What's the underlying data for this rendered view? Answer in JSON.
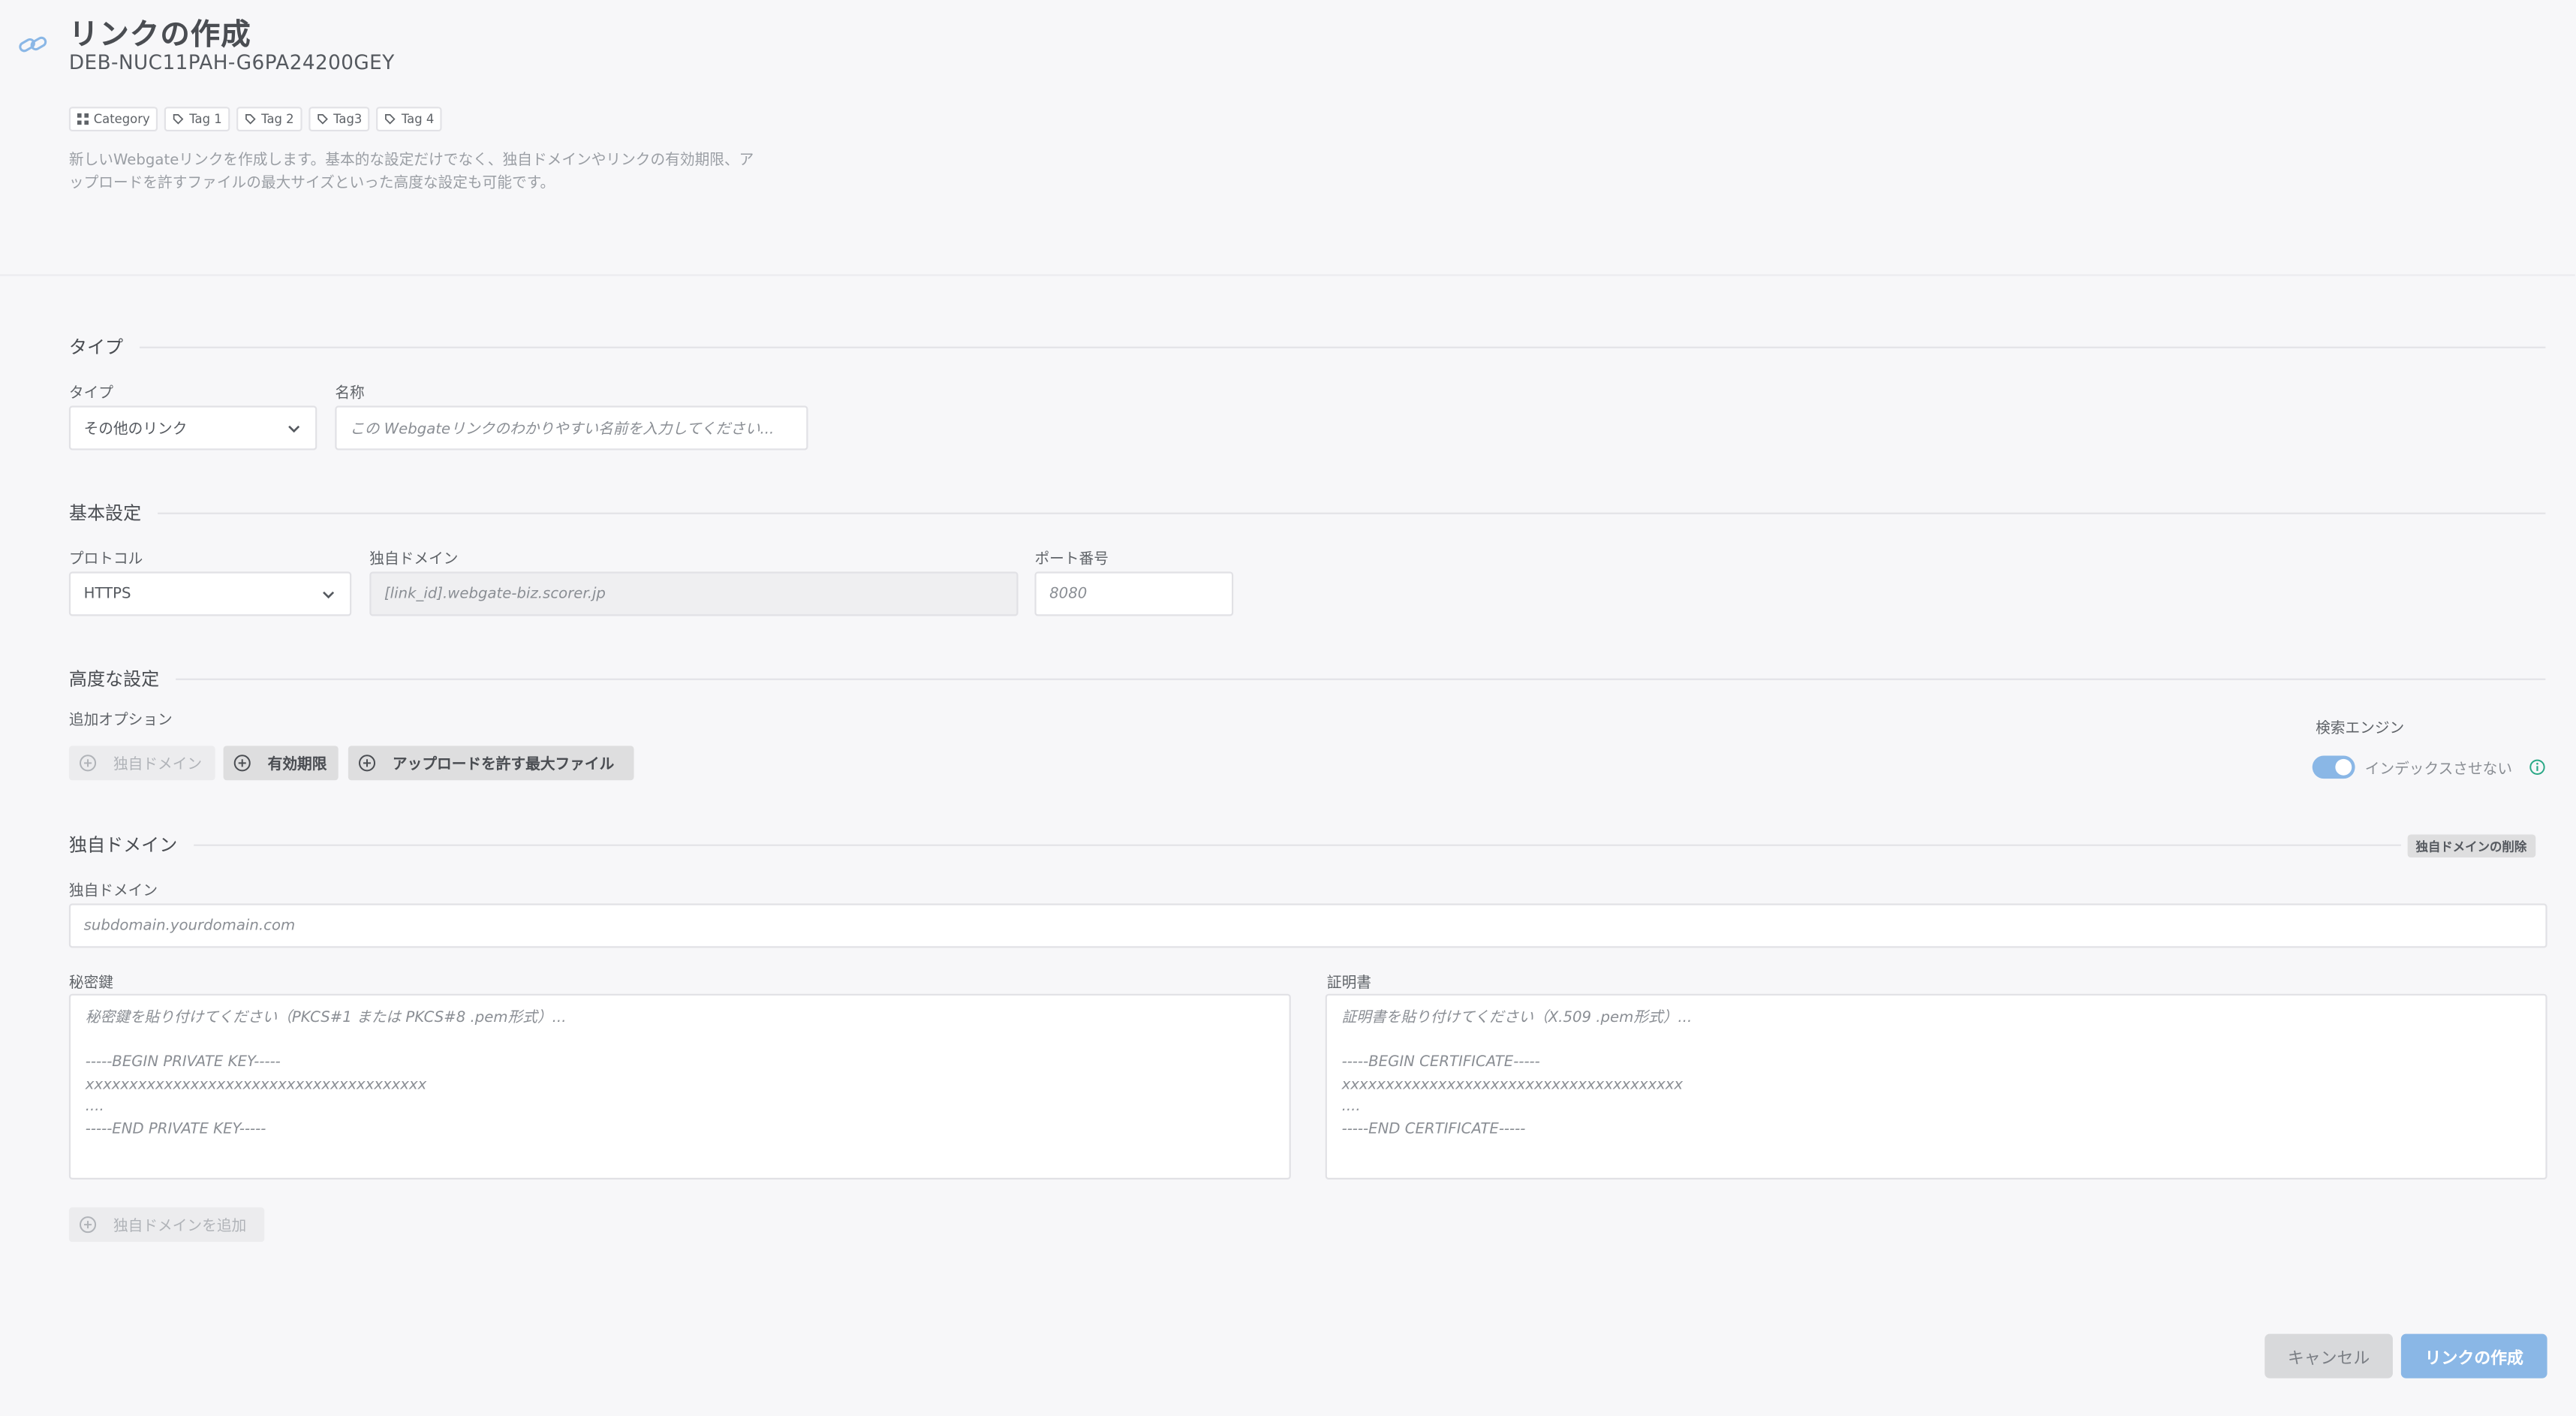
{
  "header": {
    "title": "リンクの作成",
    "subtitle": "DEB-NUC11PAH-G6PA24200GEY",
    "tags": [
      "Category",
      "Tag 1",
      "Tag 2",
      "Tag3",
      "Tag 4"
    ],
    "description_line1": "新しいWebgateリンクを作成します。基本的な設定だけでなく、独自ドメインやリンクの有効期限、ア",
    "description_line2": "ップロードを許すファイルの最大サイズといった高度な設定も可能です。"
  },
  "type_section": {
    "title": "タイプ",
    "type_label": "タイプ",
    "type_value": "その他のリンク",
    "name_label": "名称",
    "name_placeholder": "この Webgateリンクのわかりやすい名前を入力してください..."
  },
  "basic_section": {
    "title": "基本設定",
    "protocol_label": "プロトコル",
    "protocol_value": "HTTPS",
    "domain_label": "独自ドメイン",
    "domain_placeholder": "[link_id].webgate-biz.scorer.jp",
    "port_label": "ポート番号",
    "port_placeholder": "8080"
  },
  "advanced_section": {
    "title": "高度な設定",
    "options_label": "追加オプション",
    "options": [
      "独自ドメイン",
      "有効期限",
      "アップロードを許す最大ファイル"
    ],
    "search_engine_label": "検索エンジン",
    "noindex_label": "インデックスさせない",
    "noindex_enabled": true
  },
  "custom_domain_section": {
    "title": "独自ドメイン",
    "delete_label": "独自ドメインの削除",
    "domain_label": "独自ドメイン",
    "domain_placeholder": "subdomain.yourdomain.com",
    "private_key_label": "秘密鍵",
    "private_key_placeholder": "秘密鍵を貼り付けてください（PKCS#1 または PKCS#8 .pem形式）...\n\n-----BEGIN PRIVATE KEY-----\nxxxxxxxxxxxxxxxxxxxxxxxxxxxxxxxxxxxxxxx\n....\n-----END PRIVATE KEY-----",
    "certificate_label": "証明書",
    "certificate_placeholder": "証明書を貼り付けてください（X.509 .pem形式）...\n\n-----BEGIN CERTIFICATE-----\nxxxxxxxxxxxxxxxxxxxxxxxxxxxxxxxxxxxxxxx\n....\n-----END CERTIFICATE-----",
    "add_domain_label": "独自ドメインを追加"
  },
  "footer": {
    "cancel_label": "キャンセル",
    "create_label": "リンクの作成"
  },
  "colors": {
    "accent": "#8ab7e6",
    "background": "#f7f7f9"
  }
}
